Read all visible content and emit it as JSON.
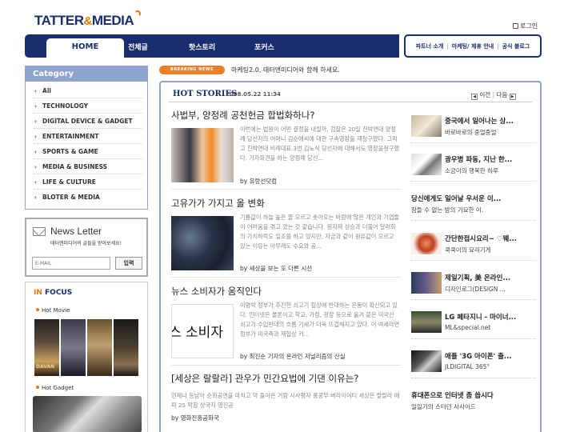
{
  "header": {
    "logo_main": "TATTER",
    "logo_amp": "&",
    "logo_tail": "MEDIA",
    "login": "로그인"
  },
  "nav": {
    "items": [
      "HOME",
      "전체글",
      "핫스토리",
      "포커스"
    ]
  },
  "subnav": {
    "items": [
      "파트너 소개",
      "마케팅/ 제휴 안내",
      "공식 블로그"
    ]
  },
  "category": {
    "title": "Category",
    "items": [
      "All",
      "TECHNOLOGY",
      "DIGITAL DEVICE & GADGET",
      "ENTERTAINMENT",
      "SPORTS & GAME",
      "MEDIA & BUSINESS",
      "LIFE & CULTURE",
      "BLOTER & MEDIA"
    ]
  },
  "newsletter": {
    "title": "News Letter",
    "subtitle": "태터앤미디어의 글들을 받아보세요!",
    "placeholder": "E-MAIL",
    "button": "입력"
  },
  "infocus": {
    "title_in": "IN",
    "title_rest": " FOCUS",
    "hot_movie": "Hot Movie",
    "hot_gadget": "Hot Gadget",
    "poster_label": "DAVAN"
  },
  "breaking": {
    "badge": "BREAKING NEWS",
    "text": "마케팅2.0, 태터앤미디어와 함께 하세요."
  },
  "hot_stories": {
    "title": "HOT STORIES",
    "date": "2008.05.22 11:34",
    "prev": "이전",
    "next": "다음",
    "stories": [
      {
        "title": "사법부, 양정례 공천헌금 합법화하나?",
        "body": "이번에는 법원이 어떤 결정을 내릴까. 검찰은 20일 친박연대 양정례 당선자의 어머니 김순애씨에 대한 구속영장을 재청구했다. 그리고 친박연대 비례대표 3번 김노식 당선자에 대해서도 영장을청구했다. 기자회견을 하는 양정례 당선...",
        "by": "by 유랑선닷컴"
      },
      {
        "title": "고유가가 가지고 올 변화",
        "body": "기름값이 하늘 높은 줄 모르고 솟아오는 바람에 많은 개인과 기업들이 어려움을 겪고 있는 것 같습니다. 원자재 상승과 더불어 달러화의 가치하락도 일조를 하고 있지만, 지금과 같이 원유값이 오르고 있는 이유는 아무래도 수요와 공...",
        "by": "by 세상을 보는 또 다른 시선"
      },
      {
        "title": "뉴스 소비자가 움직인다",
        "body": "이명박 정부가 추진한 쇠고기 협상에 반대하는 운동이 확산되고 있다. 인터넷은 물론이고 학교, 가정, 광장 등으로 옮겨 붙은 미국산 쇠고기 수입반대의 흐름 기세가 더욱 뜨겁해지고 있다. 이 여세라면 정부가 미국측과 재협상 키...",
        "by": "by 최진순 기자의 온라인 저널리즘의 산실",
        "img_text": "스 소비자"
      },
      {
        "title": "[세상은 랄랄라] 관우가 민간요법에 기댄 이유는?",
        "body": "언제나 등남아 순회공연을 마치고 막 돌아온 거렁 시사평자 홍콩무 버라이어티 세상은 랄랄라 에피 25 막장 상국지 영진공",
        "by": "by 영화진흥공화국"
      }
    ],
    "side": [
      {
        "t1": "중국에서 일어나는 상...",
        "t2": "바로바로의 중얼중얼"
      },
      {
        "t1": "광우병 파동, 지난 한...",
        "t2": "소금이의 행복한 하루"
      },
      {
        "t1": "당신에게도 일어날 우서운 이...",
        "t2": "잠들 수 없는 밤의 기묘한 이."
      },
      {
        "t1": "간단한접시요리~ ♡웨...",
        "t2": "쿡쿡이의 요리기게"
      },
      {
        "t1": "제일기획, 美 온라인...",
        "t2": "디자인로그(DESIGN ..."
      },
      {
        "t1": "LG 페타지니 - 마이너...",
        "t2": "ML&special.net"
      },
      {
        "t1": "애플 '3G 아이폰' 출...",
        "t2": "JLDIGITAL 365°"
      },
      {
        "t1": "휴대폰으로 인터넷 좀 씁시다",
        "t2": "일일기의 스터던 사사이드"
      }
    ]
  },
  "colors": {
    "navy": "#1a2d6e",
    "orange": "#e07a10",
    "border_blue": "#8fa3cf"
  }
}
